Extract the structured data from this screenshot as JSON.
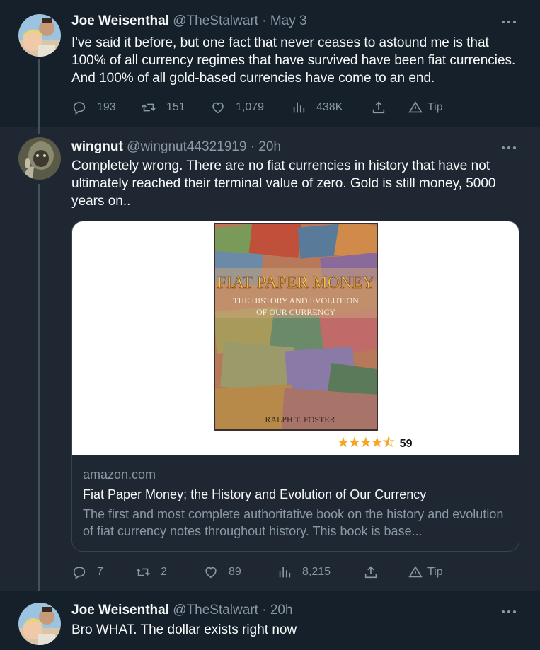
{
  "tweets": [
    {
      "name": "Joe Weisenthal",
      "handle": "@TheStalwart",
      "dot": "·",
      "time": "May 3",
      "text": "I've said it before, but one fact that never ceases to astound me is that 100% of all currency regimes that have survived have been fiat currencies. And 100% of all gold-based currencies have come to an end.",
      "replies": "193",
      "retweets": "151",
      "likes": "1,079",
      "views": "438K",
      "tip": "Tip"
    },
    {
      "name": "wingnut",
      "handle": "@wingnut44321919",
      "dot": "·",
      "time": "20h",
      "text": "Completely wrong.  There are no fiat currencies in history that have not ultimately reached their terminal value of zero.  Gold is still money, 5000 years on..",
      "replies": "7",
      "retweets": "2",
      "likes": "89",
      "views": "8,215",
      "tip": "Tip",
      "card": {
        "book_title_line1": "FIAT PAPER MONEY",
        "book_title_line2": "THE HISTORY AND EVOLUTION",
        "book_title_line3": "OF OUR CURRENCY",
        "book_author": "RALPH T. FOSTER",
        "rating_count": "59",
        "rating": 4.5,
        "domain": "amazon.com",
        "title": "Fiat Paper Money; the History and Evolution of Our Currency",
        "description": "The first and most complete authoritative book on the history and evolution of fiat currency notes throughout history. This book is base..."
      }
    },
    {
      "name": "Joe Weisenthal",
      "handle": "@TheStalwart",
      "dot": "·",
      "time": "20h",
      "text": "Bro WHAT. The dollar exists right now"
    }
  ],
  "icons": {
    "reply": "reply-icon",
    "retweet": "retweet-icon",
    "like": "heart-icon",
    "views": "views-icon",
    "share": "share-icon",
    "tip": "tip-icon",
    "more": "more-icon"
  },
  "colors": {
    "background": "#15202b",
    "highlight_background": "#1e2732",
    "text": "#f7f9f9",
    "secondary": "#8b98a5",
    "thread_line": "#42535f",
    "star": "#f5a623"
  }
}
